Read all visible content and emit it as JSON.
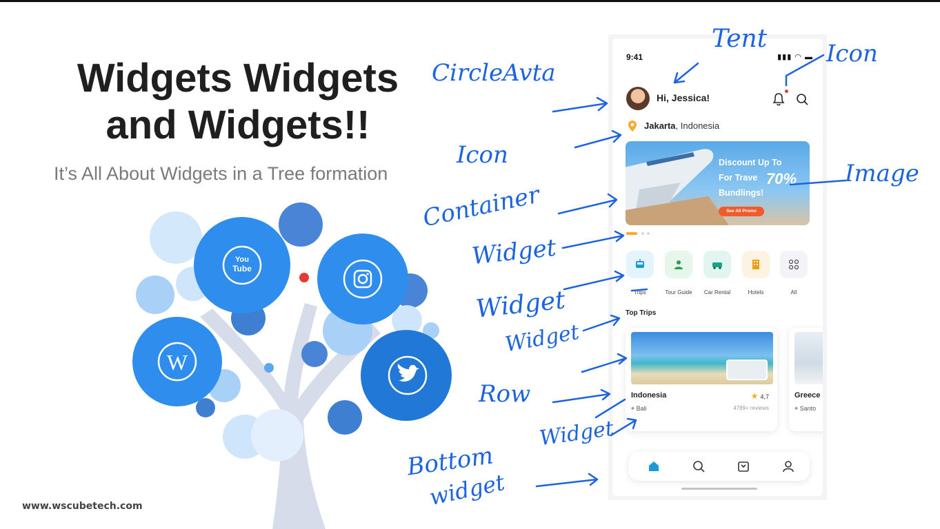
{
  "slide": {
    "title_line1": "Widgets Widgets",
    "title_line2": "and Widgets!!",
    "subtitle": "It’s All About Widgets in a Tree formation",
    "website": "www.wscubetech.com"
  },
  "tree_icons": [
    "youtube-icon",
    "instagram-icon",
    "wordpress-icon",
    "twitter-icon"
  ],
  "youtube_label": "You\nTube",
  "phone": {
    "status_time": "9:41",
    "greeting": "Hi, Jessica!",
    "location_city": "Jakarta",
    "location_country": ", Indonesia",
    "banner": {
      "line1": "Discount Up To",
      "line2": "For Trave",
      "line3": "Bundlings!",
      "percent": "70%",
      "button": "See All Promo"
    },
    "categories": [
      {
        "label": "Trips",
        "icon": "tram-icon",
        "color": "#e3f4fb"
      },
      {
        "label": "Tour Guide",
        "icon": "guide-icon",
        "color": "#e6f6ea"
      },
      {
        "label": "Car Rental",
        "icon": "car-icon",
        "color": "#e2f5f1"
      },
      {
        "label": "Hotels",
        "icon": "hotel-icon",
        "color": "#fdf3e3"
      },
      {
        "label": "All",
        "icon": "grid-icon",
        "color": "#f4f4f8"
      }
    ],
    "section_title": "Top Trips",
    "trips": [
      {
        "title": "Indonesia",
        "rating": "4,7",
        "location": "Bali",
        "reviews": "4789+ reviews"
      },
      {
        "title": "Greece",
        "location": "Santo"
      }
    ]
  },
  "annotations": {
    "text": "Tent",
    "icon_top": "Icon",
    "circle_avatar": "CircleAvta",
    "icon_left": "Icon",
    "container": "Container",
    "image": "Image",
    "widget1": "Widget",
    "widget2": "Widget",
    "widget3": "Widget",
    "row": "Row",
    "widget4": "Widget",
    "bottom_line1": "Bottom",
    "bottom_line2": "widget"
  },
  "colors": {
    "annotation_blue": "#1c63e0",
    "tree_blue": "#2f8ded",
    "accent_orange": "#f7a928"
  }
}
